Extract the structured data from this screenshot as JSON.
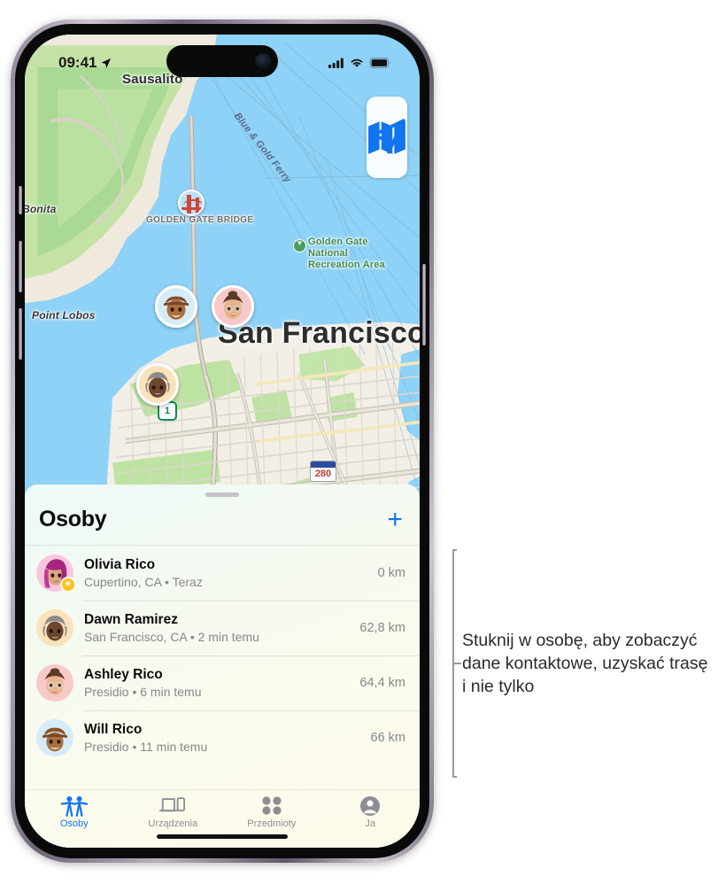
{
  "status_bar": {
    "time": "09:41",
    "location_arrow_icon": "location-arrow-icon",
    "cellular_icon": "cellular-bars-icon",
    "wifi_icon": "wifi-icon",
    "battery_icon": "battery-full-icon"
  },
  "map": {
    "labels": {
      "sausalito": "Sausalito",
      "san_francisco": "San Francisco",
      "bonita": "Bonita",
      "point_lobos": "Point Lobos",
      "ferry": "Blue & Gold Ferry",
      "golden_gate_bridge": "GOLDEN GATE BRIDGE",
      "ggnra": "Golden Gate National Recreation Area"
    },
    "route_shields": {
      "route_1": "1",
      "route_280": "280"
    },
    "controls": {
      "map_mode": {
        "label": "",
        "icon": "map-book-icon"
      },
      "locate": {
        "label": "",
        "icon": "navigation-arrow-icon"
      }
    },
    "pins": [
      {
        "name": "Will Rico",
        "bg": "#d5ecf8"
      },
      {
        "name": "Ashley Rico",
        "bg": "#f8c9c9"
      },
      {
        "name": "Dawn Ramirez",
        "bg": "#fae2bb"
      }
    ]
  },
  "sheet": {
    "title": "Osoby",
    "add_label": "+",
    "people": [
      {
        "name": "Olivia Rico",
        "subtitle": "Cupertino, CA • Teraz",
        "distance": "0 km",
        "badge": "★",
        "avatar_bg": "#f9c7dd"
      },
      {
        "name": "Dawn Ramirez",
        "subtitle": "San Francisco, CA • 2 min temu",
        "distance": "62,8 km",
        "badge": "",
        "avatar_bg": "#fae2bb"
      },
      {
        "name": "Ashley Rico",
        "subtitle": "Presidio • 6 min temu",
        "distance": "64,4 km",
        "badge": "",
        "avatar_bg": "#f8c9c9"
      },
      {
        "name": "Will Rico",
        "subtitle": "Presidio • 11 min temu",
        "distance": "66 km",
        "badge": "",
        "avatar_bg": "#d5ecf8"
      }
    ]
  },
  "tab_bar": {
    "tabs": [
      {
        "label": "Osoby",
        "icon": "two-people-icon",
        "active": true
      },
      {
        "label": "Urządzenia",
        "icon": "laptop-phone-icon",
        "active": false
      },
      {
        "label": "Przedmioty",
        "icon": "four-dots-icon",
        "active": false
      },
      {
        "label": "Ja",
        "icon": "person-circle-icon",
        "active": false
      }
    ]
  },
  "annotation": {
    "text": "Stuknij w osobę, aby zobaczyć dane kontaktowe, uzyskać trasę i nie tylko"
  },
  "colors": {
    "accent": "#1275f0",
    "water": "#8ed2f7",
    "land": "#f3efe6",
    "park": "#b9e3a0",
    "muted_text": "#87878c"
  }
}
